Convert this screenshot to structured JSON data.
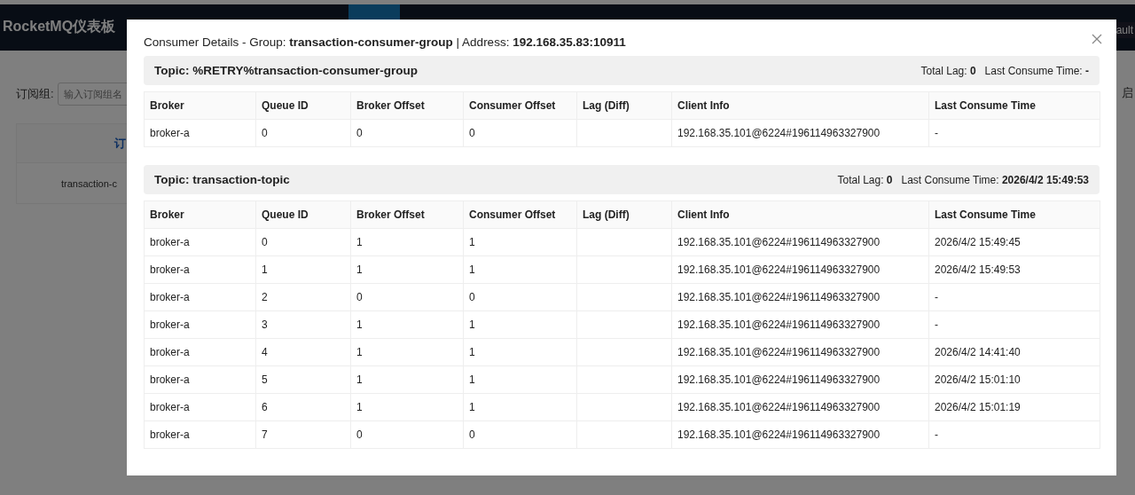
{
  "page": {
    "title": "RocketMQ仪表板",
    "nav_tabs": [
      {
        "selected": true
      }
    ],
    "nav_tail": "ault",
    "filter": {
      "label": "订阅组:",
      "placeholder": "输入订阅组名"
    },
    "side_text": "启",
    "table": {
      "header": "订",
      "cell": "transaction-c"
    }
  },
  "modal": {
    "title": "Consumer Details - Group: **transaction-consumer-group** | Address: **192.168.35.83:10911**",
    "sections": [
      {
        "topic": "Topic: %RETRY%transaction-consumer-group",
        "total_lag": "Total Lag: **0**",
        "last_time": "Last Consume Time: **-**",
        "columns": [
          "Broker",
          "Queue ID",
          "Broker Offset",
          "Consumer Offset",
          "Lag (Diff)",
          "Client Info",
          "Last Consume Time"
        ],
        "rows": [
          [
            "broker-a",
            "0",
            "0",
            "0",
            "",
            "192.168.35.101@6224#196114963327900",
            "-"
          ]
        ]
      },
      {
        "topic": "Topic: transaction-topic",
        "total_lag": "Total Lag: **0**",
        "last_time": "Last Consume Time: **2026/4/2 15:49:53**",
        "columns": [
          "Broker",
          "Queue ID",
          "Broker Offset",
          "Consumer Offset",
          "Lag (Diff)",
          "Client Info",
          "Last Consume Time"
        ],
        "rows": [
          [
            "broker-a",
            "0",
            "1",
            "1",
            "",
            "192.168.35.101@6224#196114963327900",
            "2026/4/2 15:49:45"
          ],
          [
            "broker-a",
            "1",
            "1",
            "1",
            "",
            "192.168.35.101@6224#196114963327900",
            "2026/4/2 15:49:53"
          ],
          [
            "broker-a",
            "2",
            "0",
            "0",
            "",
            "192.168.35.101@6224#196114963327900",
            "-"
          ],
          [
            "broker-a",
            "3",
            "1",
            "1",
            "",
            "192.168.35.101@6224#196114963327900",
            "-"
          ],
          [
            "broker-a",
            "4",
            "1",
            "1",
            "",
            "192.168.35.101@6224#196114963327900",
            "2026/4/2 14:41:40"
          ],
          [
            "broker-a",
            "5",
            "1",
            "1",
            "",
            "192.168.35.101@6224#196114963327900",
            "2026/4/2 15:01:10"
          ],
          [
            "broker-a",
            "6",
            "1",
            "1",
            "",
            "192.168.35.101@6224#196114963327900",
            "2026/4/2 15:01:19"
          ],
          [
            "broker-a",
            "7",
            "0",
            "0",
            "",
            "192.168.35.101@6224#196114963327900",
            "-"
          ]
        ]
      }
    ]
  }
}
